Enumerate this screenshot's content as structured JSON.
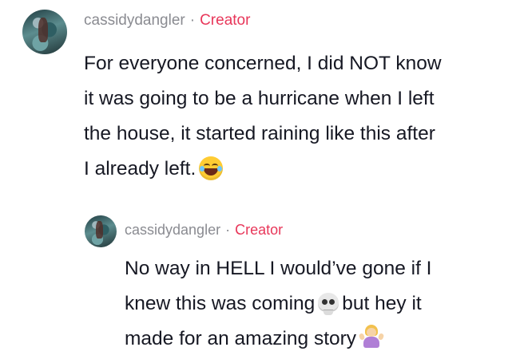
{
  "comments": [
    {
      "username": "cassidydangler",
      "separator": "·",
      "badge": "Creator",
      "lines": [
        "For everyone concerned, I did NOT know",
        "it was going to be a hurricane when I left",
        "the house, it started raining like this after",
        "I already left."
      ],
      "emoji": "laughing-with-tears-icon"
    },
    {
      "username": "cassidydangler",
      "separator": "·",
      "badge": "Creator",
      "lines": [
        "No way in HELL I would’ve gone if I",
        "knew this was coming",
        "but hey it",
        "made for an amazing story"
      ],
      "emoji": [
        "skull-icon",
        "person-shrugging-icon"
      ]
    }
  ],
  "colors": {
    "username": "#8a8b91",
    "badge": "#e8375a",
    "text": "#161823",
    "background": "#ffffff"
  }
}
